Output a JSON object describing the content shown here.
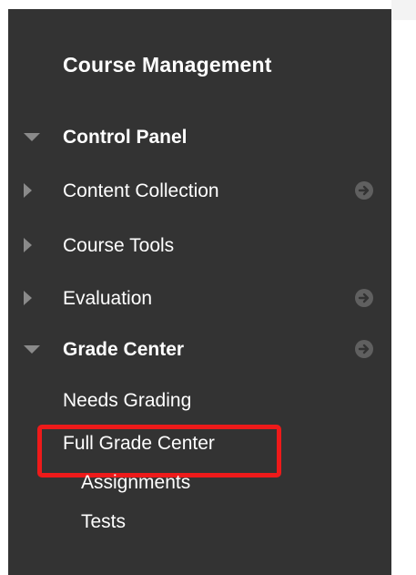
{
  "menu": {
    "title": "Course Management",
    "items": [
      {
        "label": "Control Panel",
        "expanded": true,
        "bold": true
      },
      {
        "label": "Content Collection",
        "expanded": false,
        "bold": false
      },
      {
        "label": "Course Tools",
        "expanded": false,
        "bold": false
      },
      {
        "label": "Evaluation",
        "expanded": false,
        "bold": false
      },
      {
        "label": "Grade Center",
        "expanded": true,
        "bold": true
      }
    ],
    "grade_center_links": {
      "needs_grading": "Needs Grading",
      "full_grade_center": "Full Grade Center",
      "assignments": "Assignments",
      "tests": "Tests"
    }
  },
  "colors": {
    "panel_bg": "#333333",
    "text": "#ffffff",
    "highlight": "#ee1a1a",
    "icon_gray": "#8a8a8a"
  }
}
